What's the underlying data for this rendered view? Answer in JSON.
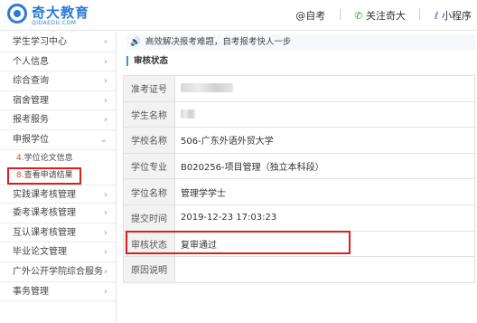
{
  "header": {
    "logo_cn": "奇大教育",
    "logo_en": "QIDAEDU.COM",
    "link_zikao": "@自考",
    "link_follow": "关注奇大",
    "link_miniprogram": "小程序",
    "colors": {
      "brand": "#2e7bd6",
      "highlight": "#e01e1e"
    }
  },
  "sidebar": {
    "items": [
      {
        "label": "学生学习中心"
      },
      {
        "label": "个人信息"
      },
      {
        "label": "综合查询"
      },
      {
        "label": "宿舍管理"
      },
      {
        "label": "报考服务"
      },
      {
        "label": "申报学位",
        "expanded": true
      }
    ],
    "subitems": [
      {
        "num": "4.",
        "label": "学位论文信息"
      },
      {
        "num": "8.",
        "label": "查看申请结果"
      }
    ],
    "items_after": [
      {
        "label": "实践课考核管理"
      },
      {
        "label": "委考课考核管理"
      },
      {
        "label": "互认课考核管理"
      },
      {
        "label": "毕业论文管理"
      },
      {
        "label": "广外公开学院综合服务"
      },
      {
        "label": "事务管理"
      }
    ]
  },
  "notice": {
    "text": "高效解决报考难题，自考报考快人一步"
  },
  "section": {
    "title": "审核状态"
  },
  "details": {
    "rows": [
      {
        "label": "准考证号",
        "value": ""
      },
      {
        "label": "学生名称",
        "value": ""
      },
      {
        "label": "学校名称",
        "value": "506-广东外语外贸大学"
      },
      {
        "label": "学位专业",
        "value": "B020256-项目管理（独立本科段）"
      },
      {
        "label": "学位名称",
        "value": "管理学学士"
      },
      {
        "label": "提交时间",
        "value": "2019-12-23 17:03:23"
      },
      {
        "label": "审核状态",
        "value": "复审通过"
      },
      {
        "label": "原因说明",
        "value": ""
      }
    ]
  }
}
